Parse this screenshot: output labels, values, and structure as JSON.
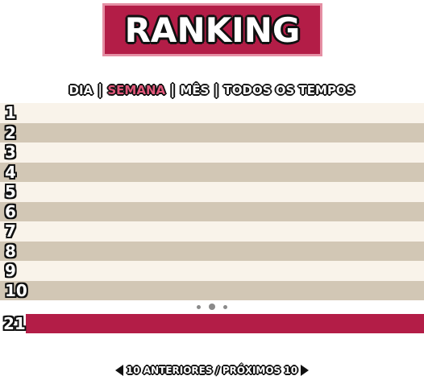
{
  "title": "RANKING",
  "tabs": [
    {
      "label": "DIA",
      "active": false
    },
    {
      "label": "SEMANA",
      "active": true
    },
    {
      "label": "MÊS",
      "active": false
    },
    {
      "label": "TODOS OS TEMPOS",
      "active": false
    }
  ],
  "separator": "|",
  "ranks": [
    "1",
    "2",
    "3",
    "4",
    "5",
    "6",
    "7",
    "8",
    "9",
    "10"
  ],
  "player_rank": "21",
  "pager": {
    "prev_label": "10 ANTERIORES",
    "separator": "/",
    "next_label": "PRÓXIMOS 10"
  },
  "colors": {
    "banner": "#b31d47",
    "banner_border": "#e58fa4",
    "row_light": "#f9f3ea",
    "row_dark": "#d2c7b5",
    "active_tab": "#e0587a"
  }
}
